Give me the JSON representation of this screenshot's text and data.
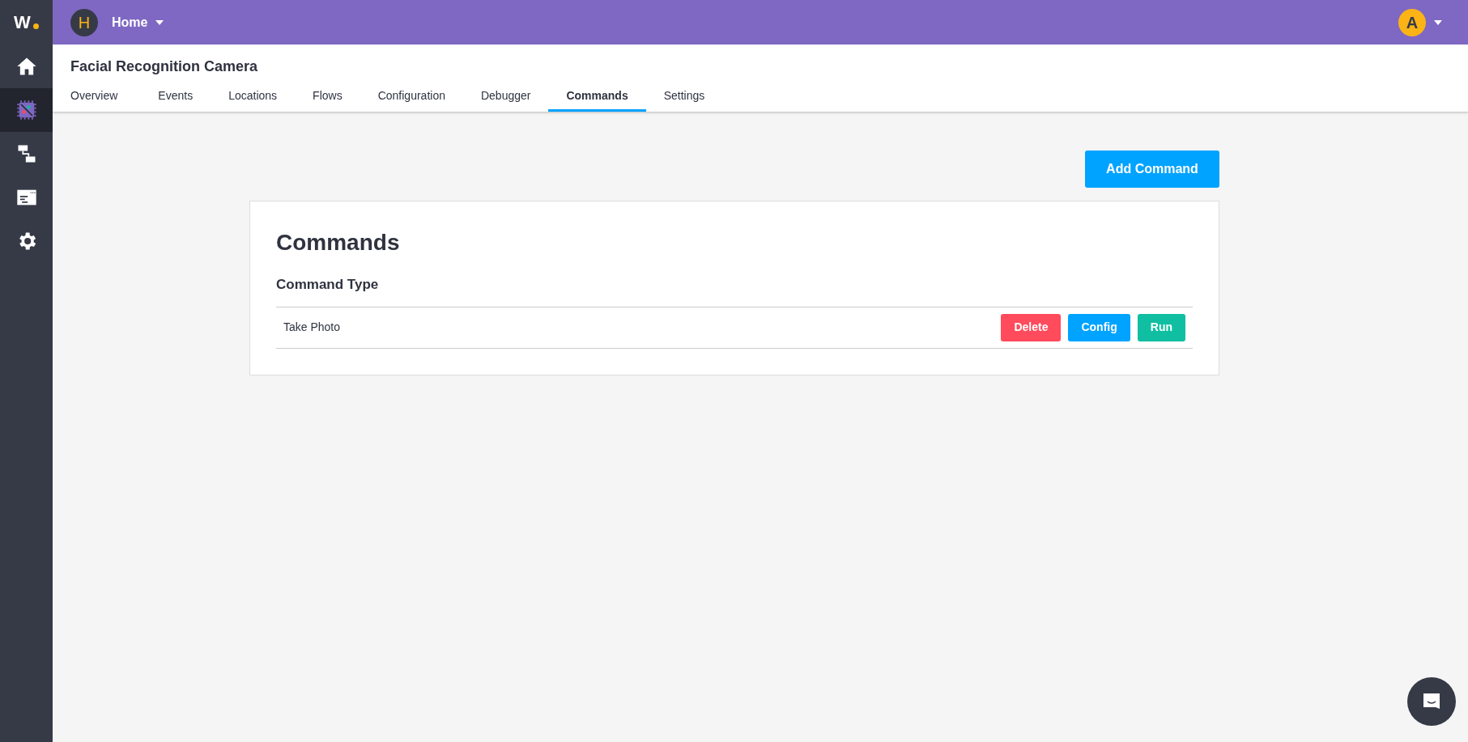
{
  "sidebar": {
    "logo": "W",
    "items": [
      {
        "kind": "home",
        "selected": false
      },
      {
        "kind": "device",
        "selected": true
      },
      {
        "kind": "flow",
        "selected": false
      },
      {
        "kind": "console",
        "selected": false
      },
      {
        "kind": "settings",
        "selected": false
      }
    ]
  },
  "topbar": {
    "app_initial": "H",
    "app_name": "Home",
    "user_initial": "A"
  },
  "header": {
    "title": "Facial Recognition Camera",
    "tabs": [
      {
        "label": "Overview",
        "selected": false
      },
      {
        "label": "Events",
        "selected": false
      },
      {
        "label": "Locations",
        "selected": false
      },
      {
        "label": "Flows",
        "selected": false
      },
      {
        "label": "Configuration",
        "selected": false
      },
      {
        "label": "Debugger",
        "selected": false
      },
      {
        "label": "Commands",
        "selected": true
      },
      {
        "label": "Settings",
        "selected": false
      }
    ]
  },
  "add_button": "Add Command",
  "card": {
    "title": "Commands",
    "column": "Command Type",
    "rows": [
      {
        "name": "Take Photo",
        "actions": [
          {
            "label": "Delete",
            "kind": "danger"
          },
          {
            "label": "Config",
            "kind": "primary"
          },
          {
            "label": "Run",
            "kind": "success"
          }
        ]
      }
    ]
  }
}
